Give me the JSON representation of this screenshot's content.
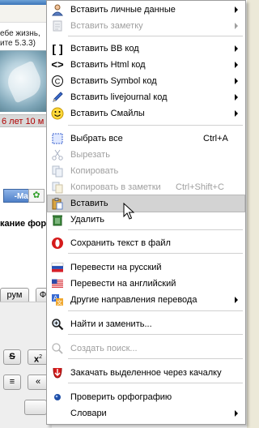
{
  "background": {
    "quote_line1": "ебе жизнь,",
    "quote_line2": "ите 5.3.3)",
    "age_text": "6 лет 10 м",
    "email_button": "-Mail",
    "heading": "кание фору",
    "forum_button": "рум",
    "forum_button2": "Ф"
  },
  "menu": {
    "groups": [
      [
        {
          "name": "insert-personal-data",
          "label": "Вставить личные данные",
          "icon": "person-icon",
          "submenu": true,
          "disabled": false
        },
        {
          "name": "insert-note",
          "label": "Вставить заметку",
          "icon": "note-icon",
          "submenu": true,
          "disabled": true
        }
      ],
      [
        {
          "name": "insert-bb-code",
          "label": "Вставить BB код",
          "icon": "brackets-icon",
          "submenu": true,
          "disabled": false
        },
        {
          "name": "insert-html-code",
          "label": "Вставить Html код",
          "icon": "code-icon",
          "submenu": true,
          "disabled": false
        },
        {
          "name": "insert-symbol-code",
          "label": "Вставить Symbol код",
          "icon": "copyright-icon",
          "submenu": true,
          "disabled": false
        },
        {
          "name": "insert-livejournal-code",
          "label": "Вставить livejournal код",
          "icon": "pencil-icon",
          "submenu": true,
          "disabled": false
        },
        {
          "name": "insert-smiles",
          "label": "Вставить Смайлы",
          "icon": "smiley-icon",
          "submenu": true,
          "disabled": false
        }
      ],
      [
        {
          "name": "select-all",
          "label": "Выбрать все",
          "shortcut": "Ctrl+A",
          "icon": "select-all-icon",
          "disabled": false
        },
        {
          "name": "cut",
          "label": "Вырезать",
          "icon": "scissors-icon",
          "disabled": true
        },
        {
          "name": "copy",
          "label": "Копировать",
          "icon": "copy-icon",
          "disabled": true
        },
        {
          "name": "copy-to-notes",
          "label": "Копировать в заметки",
          "shortcut": "Ctrl+Shift+C",
          "icon": "copy-notes-icon",
          "disabled": true
        },
        {
          "name": "paste",
          "label": "Вставить",
          "icon": "paste-icon",
          "disabled": false,
          "highlighted": true
        },
        {
          "name": "delete",
          "label": "Удалить",
          "icon": "trash-icon",
          "disabled": false
        }
      ],
      [
        {
          "name": "save-text-to-file",
          "label": "Сохранить текст в файл",
          "icon": "opera-save-icon",
          "disabled": false
        }
      ],
      [
        {
          "name": "translate-ru",
          "label": "Перевести на русский",
          "icon": "flag-ru-icon",
          "disabled": false
        },
        {
          "name": "translate-en",
          "label": "Перевести на английский",
          "icon": "flag-us-icon",
          "disabled": false
        },
        {
          "name": "other-translation",
          "label": "Другие направления перевода",
          "icon": "translate-icon",
          "submenu": true,
          "disabled": false
        }
      ],
      [
        {
          "name": "find-replace",
          "label": "Найти и заменить...",
          "icon": "magnifier-icon",
          "disabled": false
        }
      ],
      [
        {
          "name": "create-search",
          "label": "Создать поиск...",
          "icon": "search-icon",
          "disabled": true
        }
      ],
      [
        {
          "name": "download-selected",
          "label": "Закачать выделенное через качалку",
          "icon": "download-icon",
          "disabled": false
        }
      ],
      [
        {
          "name": "spellcheck",
          "label": "Проверить орфографию",
          "icon": "radio-dot-icon",
          "disabled": false
        },
        {
          "name": "dictionaries",
          "label": "Словари",
          "icon": "",
          "submenu": true,
          "disabled": false
        }
      ]
    ]
  },
  "colors": {
    "highlight": "#d3d3d3",
    "disabled_text": "#9f9f9f",
    "menu_border": "#9d9d9d"
  }
}
